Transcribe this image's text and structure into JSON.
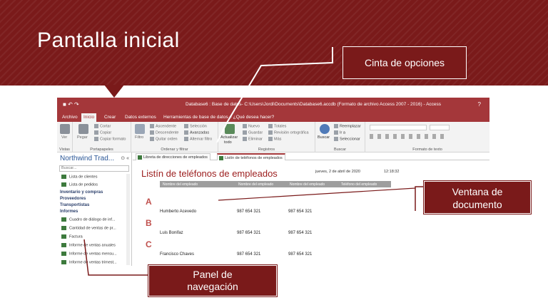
{
  "slide": {
    "title": "Pantalla inicial",
    "callouts": {
      "ribbon": "Cinta de opciones",
      "document_line1": "Ventana de",
      "document_line2": "documento",
      "nav_line1": "Panel de",
      "nav_line2": "navegación"
    },
    "colors": {
      "band": "#7a1a1a",
      "access_accent": "#a4373a"
    }
  },
  "window": {
    "title": "Database6 : Base de datos- C:\\Users\\Jordi\\Documents\\Database6.accdb (Formato de archivo Access 2007 - 2016) - Access",
    "help": "?",
    "qat_icons": [
      "save-icon",
      "undo-icon",
      "redo-icon"
    ]
  },
  "ribbon_tabs": [
    "Archivo",
    "Inicio",
    "Crear",
    "Datos externos",
    "Herramientas de base de datos"
  ],
  "tell_me": "¿Qué desea hacer?",
  "ribbon": {
    "vistas": {
      "ver": "Ver",
      "label": "Vistas"
    },
    "portapapeles": {
      "pegar": "Pegar",
      "cortar": "Cortar",
      "copiar": "Copiar",
      "copiar_formato": "Copiar formato",
      "label": "Portapapeles"
    },
    "ordenar": {
      "filtro": "Filtro",
      "ascendente": "Ascendente",
      "descendente": "Descendente",
      "quitar_orden": "Quitar orden",
      "seleccion": "Selección",
      "avanzadas": "Avanzadas",
      "alternar_filtro": "Alternar filtro",
      "label": "Ordenar y filtrar"
    },
    "registros": {
      "actualizar": "Actualizar",
      "todo": "todo",
      "nuevo": "Nuevo",
      "guardar": "Guardar",
      "eliminar": "Eliminar",
      "totales": "Totales",
      "revision": "Revisión ortográfica",
      "mas": "Más",
      "label": "Registros"
    },
    "buscar": {
      "buscar": "Buscar",
      "reemplazar": "Reemplazar",
      "ir_a": "Ir a",
      "seleccionar": "Seleccionar",
      "label": "Buscar"
    },
    "formato": {
      "label": "Formato de texto"
    }
  },
  "nav": {
    "title": "Northwind Trad...",
    "search_placeholder": "Buscar...",
    "items": [
      {
        "label": "Lista de clientes",
        "kind": "item"
      },
      {
        "label": "Lista de pedidos",
        "kind": "item"
      },
      {
        "label": "Inventario y compras",
        "kind": "group"
      },
      {
        "label": "Proveedores",
        "kind": "group"
      },
      {
        "label": "Transportistas",
        "kind": "group"
      },
      {
        "label": "Informes",
        "kind": "group"
      },
      {
        "label": "Cuadro de diálogo de inf...",
        "kind": "item"
      },
      {
        "label": "Cantidad de ventas de pr...",
        "kind": "item"
      },
      {
        "label": "Factura",
        "kind": "item"
      },
      {
        "label": "Informe de ventas anuales",
        "kind": "item"
      },
      {
        "label": "Informe de ventas mensu...",
        "kind": "item"
      },
      {
        "label": "Informe de ventas trimest...",
        "kind": "item"
      }
    ]
  },
  "doc_tabs": [
    "Libreta de direcciones de empleados",
    "Listín de teléfonos de empleados"
  ],
  "report": {
    "title": "Listín de teléfonos de empleados",
    "date": "jueves, 2 de abril de 2020",
    "time": "12:18:32",
    "headers": [
      "Nombre del empleado",
      "Nombre del empleado",
      "Nombre del empleado",
      "Teléfono del empleado"
    ],
    "sections": [
      {
        "letter": "A",
        "name": "Humberto Acevedo",
        "phone1": "987 654 321",
        "phone2": "987 654 321"
      },
      {
        "letter": "B",
        "name": "Luis Bonifaz",
        "phone1": "987 654 321",
        "phone2": "987 654 321"
      },
      {
        "letter": "C",
        "name": "Francisco Chaves",
        "phone1": "987 654 321",
        "phone2": "987 654 321"
      }
    ]
  }
}
